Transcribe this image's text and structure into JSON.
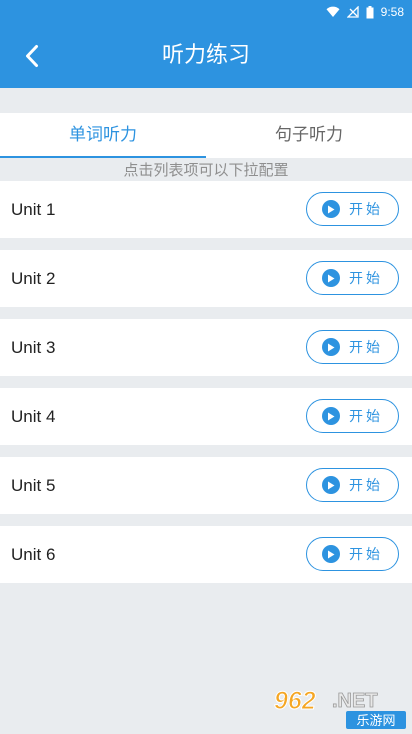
{
  "status_bar": {
    "time": "9:58"
  },
  "header": {
    "title": "听力练习"
  },
  "tabs": [
    {
      "label": "单词听力",
      "active": true
    },
    {
      "label": "句子听力",
      "active": false
    }
  ],
  "hint": "点击列表项可以下拉配置",
  "units": [
    {
      "label": "Unit 1",
      "button": "开始"
    },
    {
      "label": "Unit 2",
      "button": "开始"
    },
    {
      "label": "Unit 3",
      "button": "开始"
    },
    {
      "label": "Unit 4",
      "button": "开始"
    },
    {
      "label": "Unit 5",
      "button": "开始"
    },
    {
      "label": "Unit 6",
      "button": "开始"
    }
  ],
  "watermark": {
    "brand": "962.NET",
    "sub": "乐游网"
  },
  "colors": {
    "primary": "#2d93e0",
    "background": "#e9ecef"
  },
  "icons": [
    "wifi-icon",
    "signal-icon",
    "battery-icon",
    "back-arrow-icon",
    "play-icon"
  ]
}
